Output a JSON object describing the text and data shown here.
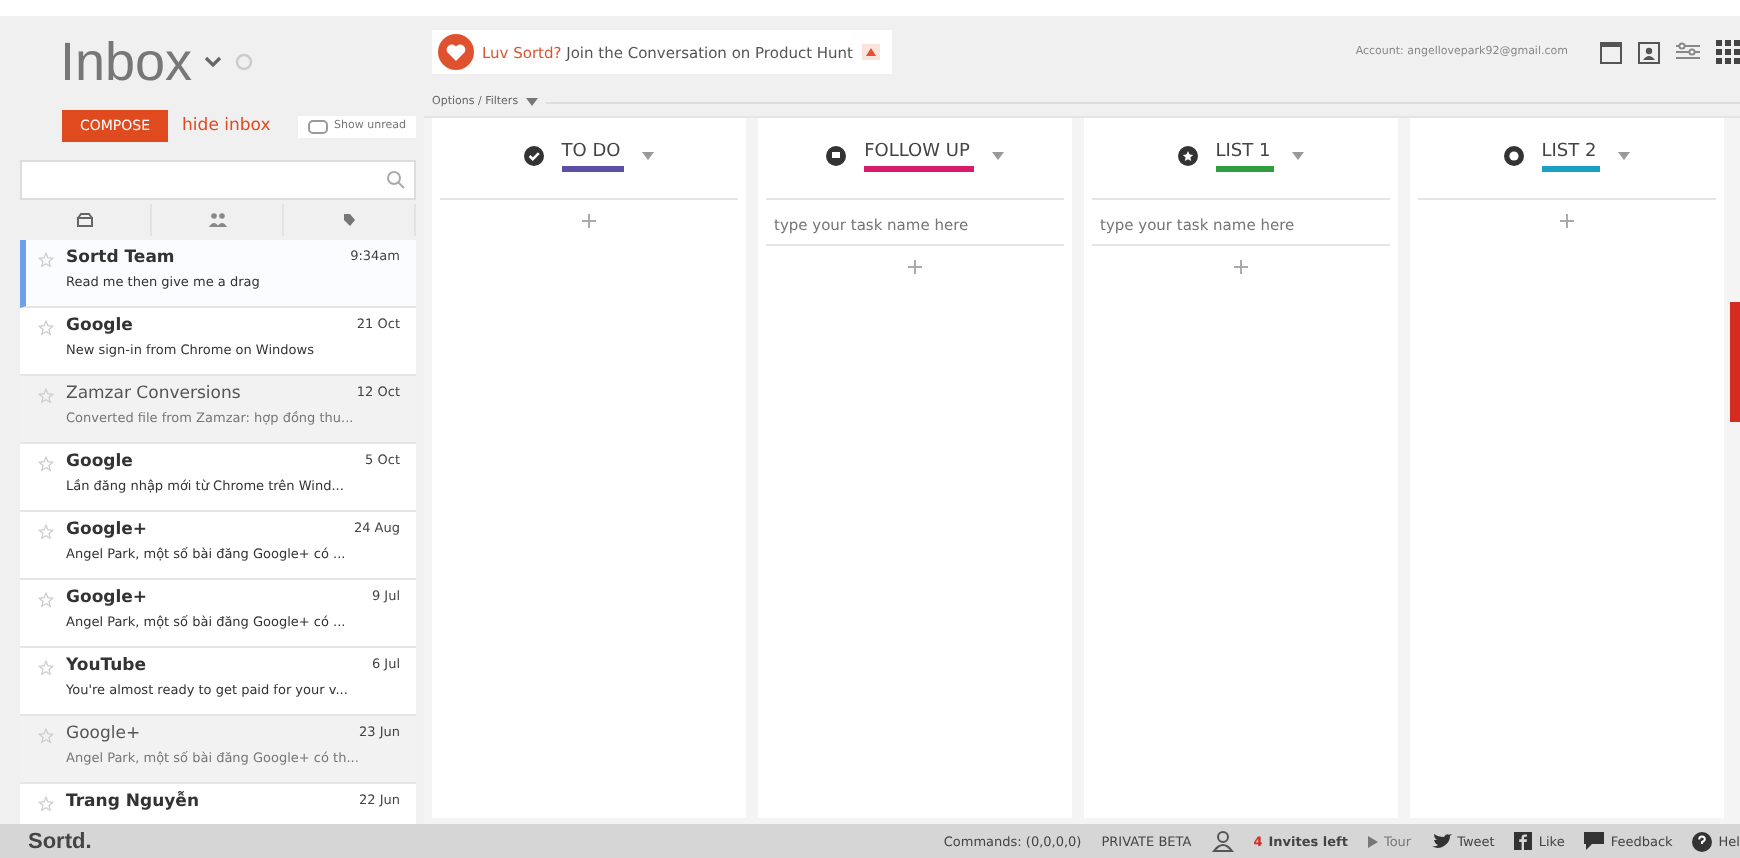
{
  "sidebar": {
    "title": "Inbox",
    "compose": "COMPOSE",
    "hide_inbox": "hide inbox",
    "show_unread": "Show unread",
    "emails": [
      {
        "sender": "Sortd Team",
        "date": "9:34am",
        "preview": "Read me then give me a drag",
        "read": false,
        "selected": true
      },
      {
        "sender": "Google",
        "date": "21 Oct",
        "preview": "New sign-in from Chrome on Windows",
        "read": false,
        "selected": false
      },
      {
        "sender": "Zamzar Conversions",
        "date": "12 Oct",
        "preview": "Converted file from Zamzar: hợp đồng thu...",
        "read": true,
        "selected": false
      },
      {
        "sender": "Google",
        "date": "5 Oct",
        "preview": "Lần đăng nhập mới từ Chrome trên Wind...",
        "read": false,
        "selected": false
      },
      {
        "sender": "Google+",
        "date": "24 Aug",
        "preview": "Angel Park, một số bài đăng Google+ có ...",
        "read": false,
        "selected": false
      },
      {
        "sender": "Google+",
        "date": "9 Jul",
        "preview": "Angel Park, một số bài đăng Google+ có ...",
        "read": false,
        "selected": false
      },
      {
        "sender": "YouTube",
        "date": "6 Jul",
        "preview": "You're almost ready to get paid for your v...",
        "read": false,
        "selected": false
      },
      {
        "sender": "Google+",
        "date": "23 Jun",
        "preview": "Angel Park, một số bài đăng Google+ có th...",
        "read": true,
        "selected": false
      },
      {
        "sender": "Trang Nguyễn",
        "date": "22 Jun",
        "read": false,
        "selected": false
      }
    ]
  },
  "banner": {
    "highlight": "Luv Sortd?",
    "text": "Join the Conversation on Product Hunt"
  },
  "options": "Options / Filters",
  "account": "Account: angellovepark92@gmail.com",
  "lists": [
    {
      "title": "TO DO",
      "color": "#5b4fa8",
      "kind": "plus"
    },
    {
      "title": "FOLLOW UP",
      "color": "#d81b6a",
      "kind": "input",
      "placeholder": "type your task name here"
    },
    {
      "title": "LIST 1",
      "color": "#2e9e3e",
      "kind": "input",
      "placeholder": "type your task name here"
    },
    {
      "title": "LIST 2",
      "color": "#1ba0c4",
      "kind": "plus"
    }
  ],
  "footer": {
    "logo": "Sortd.",
    "commands": "Commands: (0,0,0,0)",
    "beta": "PRIVATE BETA",
    "invites_count": "4",
    "invites": "Invites left",
    "tour": "Tour",
    "tweet": "Tweet",
    "like": "Like",
    "feedback": "Feedback",
    "help": "Hel"
  }
}
